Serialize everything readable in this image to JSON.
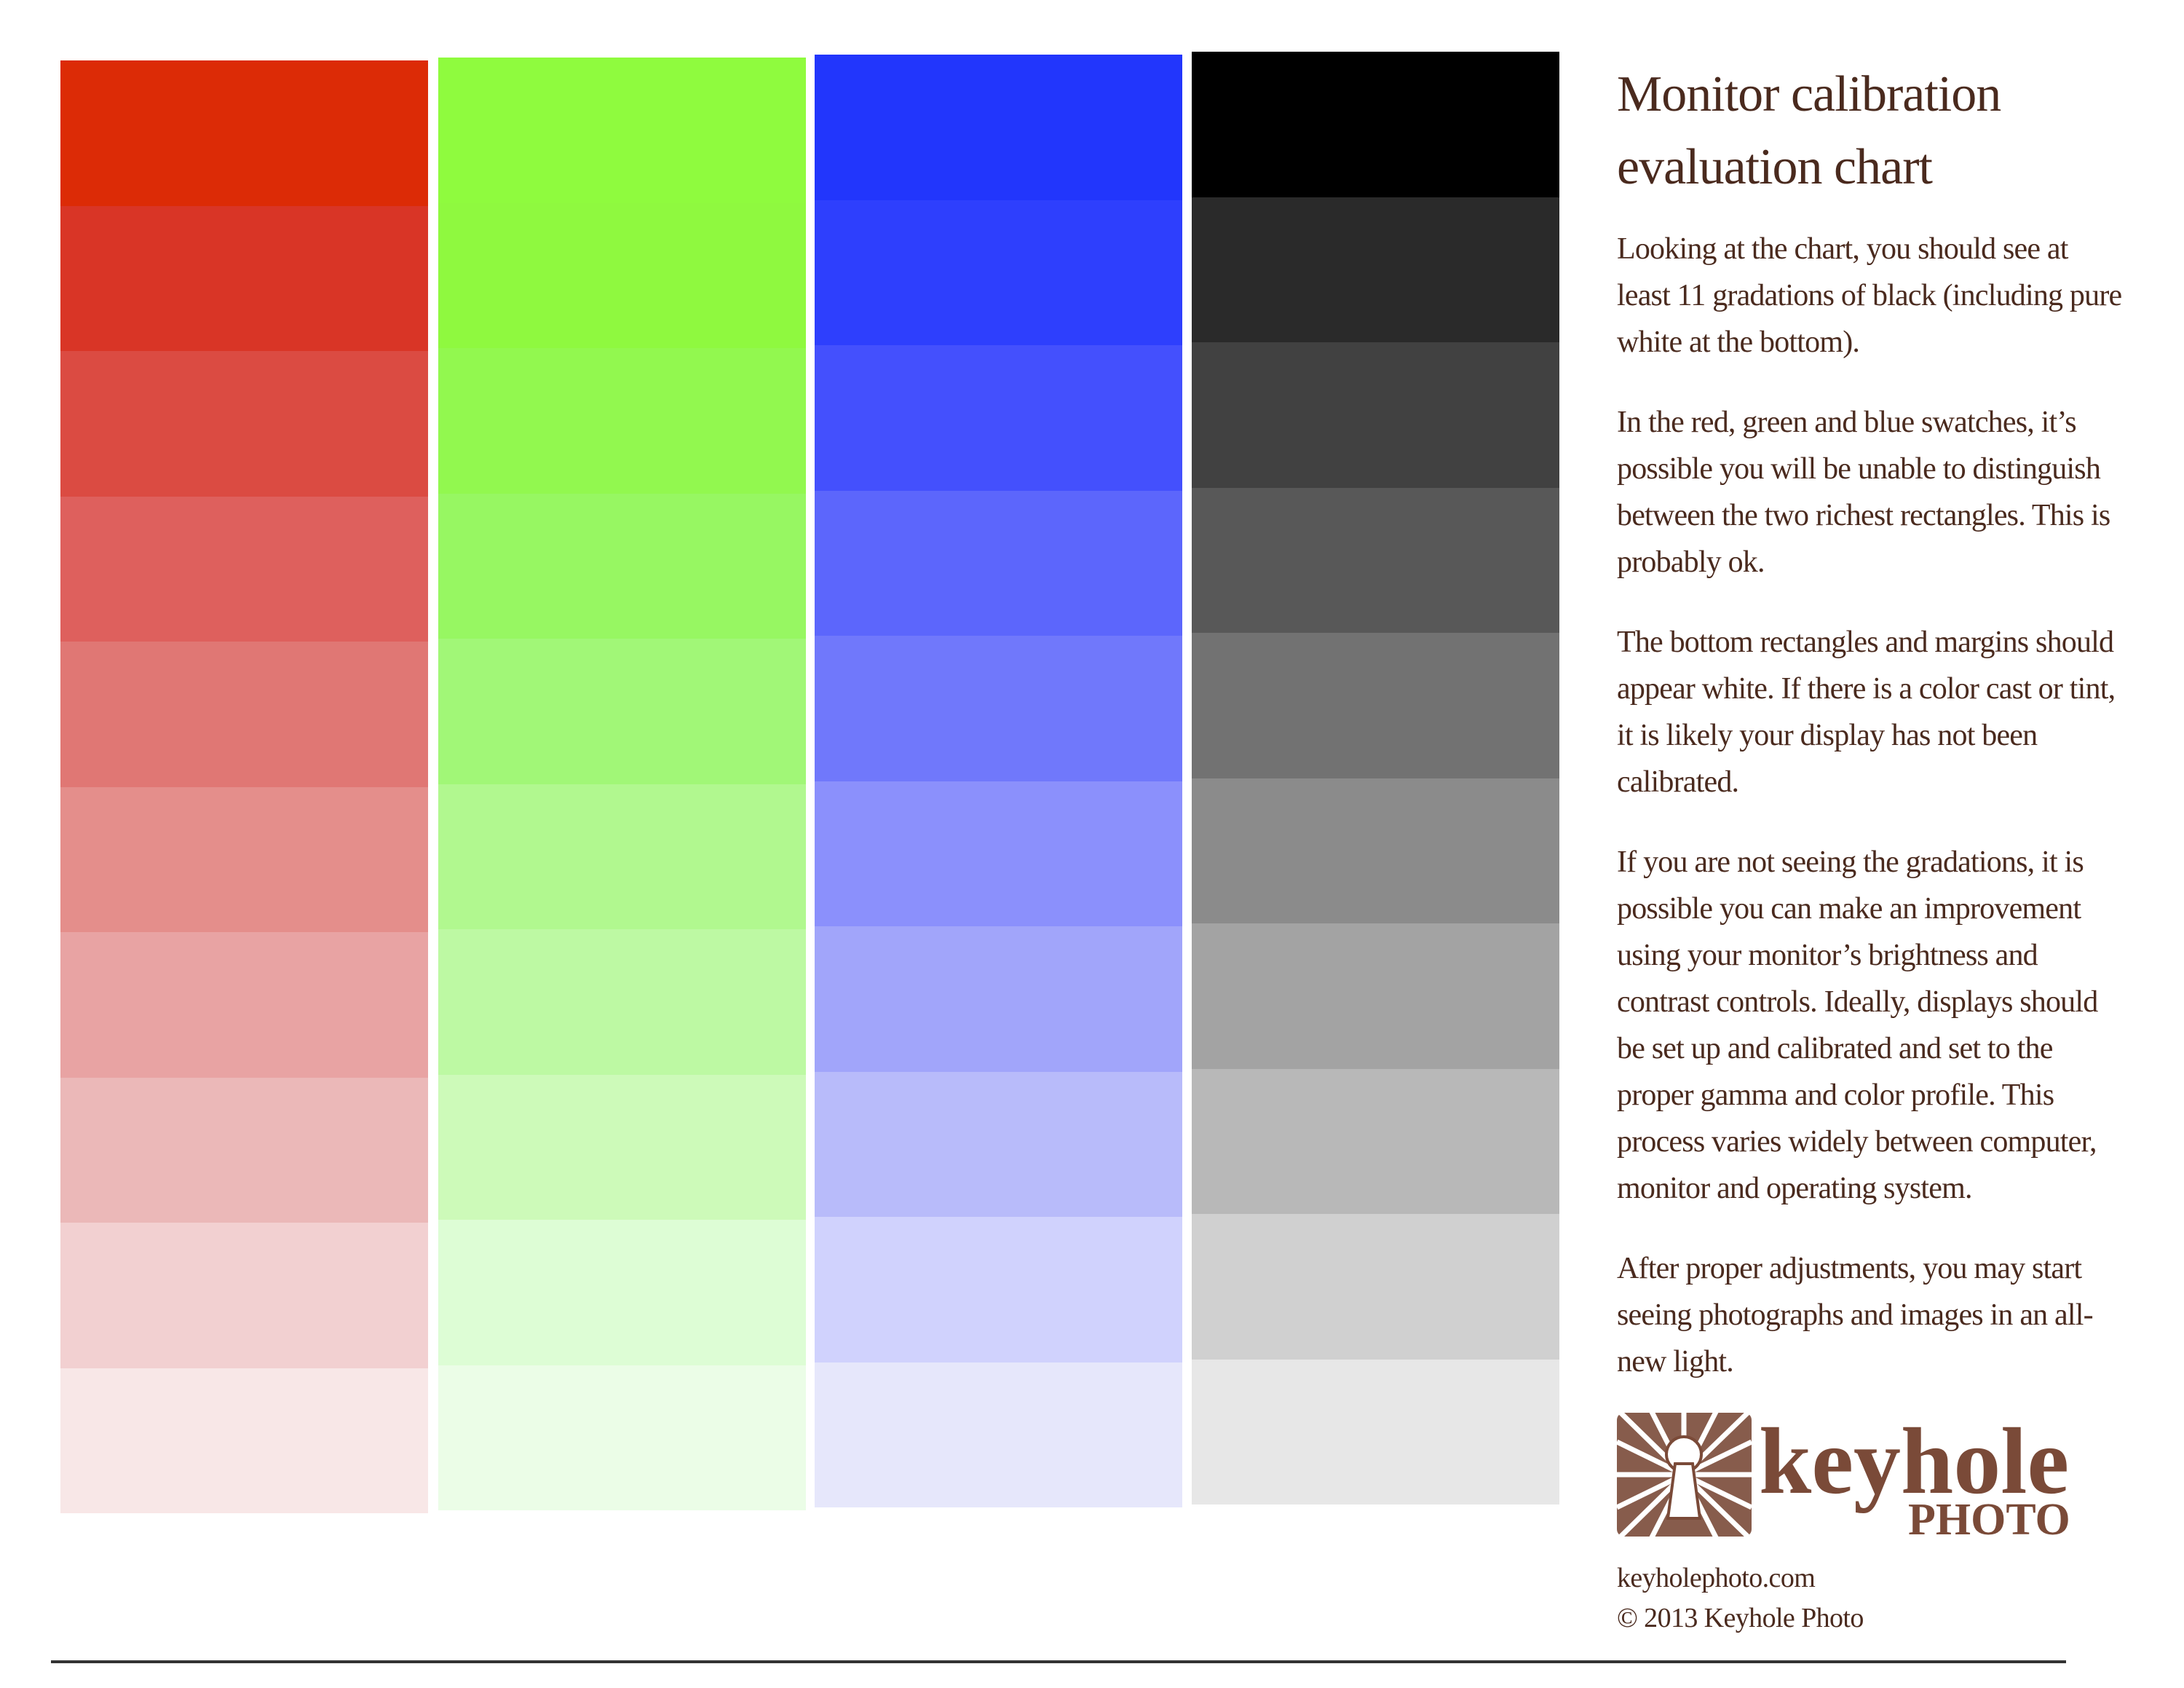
{
  "title_lines": [
    "Monitor calibration",
    "evaluation chart"
  ],
  "paragraphs": [
    "Looking at the chart, you should see at least 11 gradations of black (including pure white at the bottom).",
    "In the red, green and blue swatches, it’s possible you will be unable to distinguish between the two richest rectangles. This is probably ok.",
    "The bottom rectangles and margins should appear white. If there is a color cast or tint, it is likely your display has not been calibrated.",
    "If you are not seeing the gradations, it is possible you can make an improvement using your monitor’s brightness and contrast controls. Ideally, displays should be set up and calibrated and set to the proper gamma and color profile. This process varies widely between computer, monitor and operating system.",
    "After proper adjustments, you may start seeing photographs and images in an all-new light."
  ],
  "logo": {
    "word": "keyhole",
    "sub": "PHOTO",
    "icon": "keyhole-sunburst-icon",
    "color": "#7a4a38"
  },
  "website": "keyholephoto.com",
  "copyright": "© 2013 Keyhole Photo",
  "text_color": "#4a2a1e",
  "swatch_columns": [
    {
      "name": "red",
      "colors": [
        "#dc2b06",
        "#d93526",
        "#db4b42",
        "#de605d",
        "#e07774",
        "#e48e8b",
        "#e8a3a3",
        "#ebb8b8",
        "#f2d0d1",
        "#f8e7e7"
      ]
    },
    {
      "name": "green",
      "colors": [
        "#8ffb3e",
        "#8ff93f",
        "#92f84f",
        "#97f762",
        "#a1f777",
        "#b1f88f",
        "#bdf9a3",
        "#cdfab9",
        "#ddfdd5",
        "#ebfde7"
      ]
    },
    {
      "name": "blue",
      "colors": [
        "#2236fc",
        "#2e3ffd",
        "#4450fd",
        "#5c66fc",
        "#7078fb",
        "#8b90fc",
        "#a1a5fa",
        "#b8bbfa",
        "#d0d2fd",
        "#e6e7fb"
      ]
    },
    {
      "name": "gray",
      "colors": [
        "#000000",
        "#2a2a2a",
        "#414141",
        "#585858",
        "#727272",
        "#8b8b8b",
        "#a3a3a3",
        "#b8b8b8",
        "#d0d0d0",
        "#e7e7e7"
      ]
    }
  ]
}
